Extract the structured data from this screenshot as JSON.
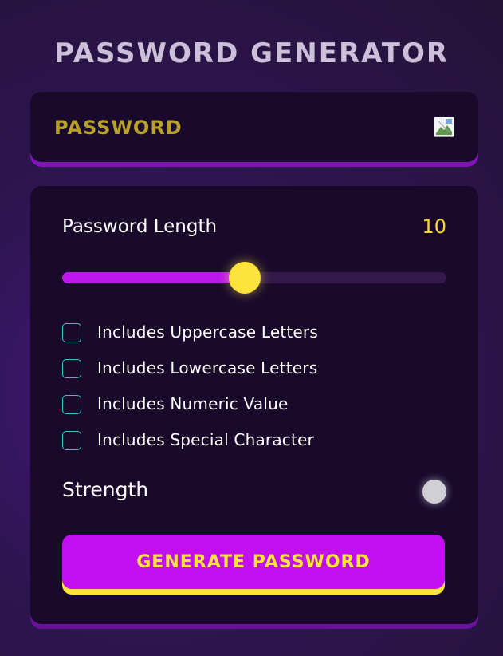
{
  "app": {
    "title": "PASSWORD GENERATOR"
  },
  "display": {
    "placeholder": "PASSWORD",
    "copy_icon": "broken-image-icon"
  },
  "length": {
    "label": "Password Length",
    "value": "10",
    "slider_fraction": 0.475
  },
  "options": [
    {
      "label": "Includes Uppercase Letters",
      "checked": false
    },
    {
      "label": "Includes Lowercase Letters",
      "checked": false
    },
    {
      "label": "Includes Numeric Value",
      "checked": false
    },
    {
      "label": "Includes Special Character",
      "checked": false
    }
  ],
  "strength": {
    "label": "Strength",
    "indicator_color": "#cfcfd4"
  },
  "generate": {
    "label": "GENERATE PASSWORD"
  },
  "colors": {
    "accent_yellow": "#fde33c",
    "accent_purple": "#c10ff0",
    "checkbox_teal": "#26c9c9",
    "panel": "#190a2c"
  }
}
